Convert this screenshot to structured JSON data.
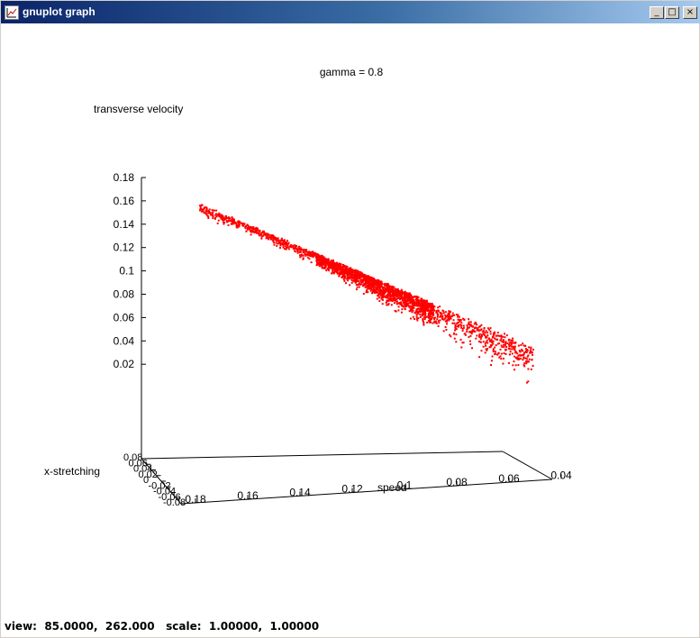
{
  "window": {
    "title": "gnuplot graph",
    "icon": "gnuplot-app-icon",
    "controls": {
      "minimize": "_",
      "maximize": "□",
      "close": "×"
    }
  },
  "status": {
    "view_label": "view:",
    "view_value": "85.0000,  262.000",
    "scale_label": "scale:",
    "scale_value": "1.00000,  1.00000"
  },
  "chart_data": {
    "type": "scatter",
    "title": "gamma = 0.8",
    "zlabel": "transverse velocity",
    "xlabel": "speed",
    "ylabel": "x-stretching",
    "point_color": "#ff0000",
    "z_ticks": [
      "0.18",
      "0.16",
      "0.14",
      "0.12",
      "0.1",
      "0.08",
      "0.06",
      "0.04",
      "0.02"
    ],
    "x_ticks": [
      "0.18",
      "0.16",
      "0.14",
      "0.12",
      "0.1",
      "0.08",
      "0.06",
      "0.04"
    ],
    "y_ticks": [
      "0.08",
      "0.06",
      "0.04",
      "0.02",
      "0",
      "-0.02",
      "-0.04",
      "-0.06",
      "-0.08"
    ],
    "zlim": [
      0,
      0.18
    ],
    "xlim": [
      0.04,
      0.18
    ],
    "trend": [
      {
        "speed": 0.158,
        "tv": 0.155
      },
      {
        "speed": 0.1,
        "tv": 0.095
      },
      {
        "speed": 0.06,
        "tv": 0.055
      },
      {
        "speed": 0.03,
        "tv": 0.033
      }
    ]
  }
}
